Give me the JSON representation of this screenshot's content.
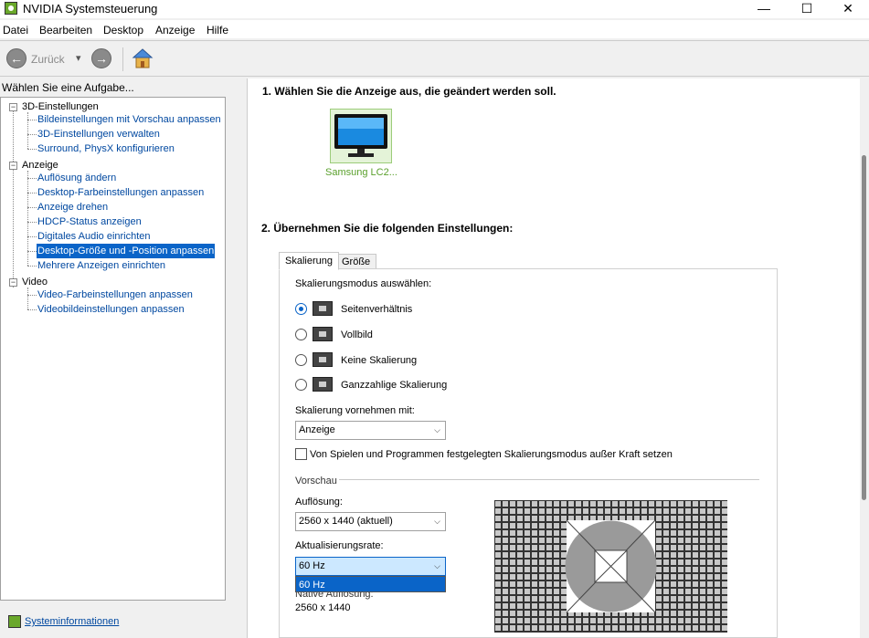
{
  "window": {
    "title": "NVIDIA Systemsteuerung",
    "controls": {
      "minimize": "—",
      "maximize": "☐",
      "close": "✕"
    }
  },
  "menu": [
    "Datei",
    "Bearbeiten",
    "Desktop",
    "Anzeige",
    "Hilfe"
  ],
  "toolbar": {
    "back_label": "Zurück",
    "back_arrow": "←",
    "forward_arrow": "→",
    "dropdown_caret": "▾"
  },
  "sidebar": {
    "task_label": "Wählen Sie eine Aufgabe...",
    "categories": [
      {
        "label": "3D-Einstellungen",
        "toggle": "−",
        "items": [
          {
            "label": "Bildeinstellungen mit Vorschau anpassen"
          },
          {
            "label": "3D-Einstellungen verwalten"
          },
          {
            "label": "Surround, PhysX konfigurieren"
          }
        ]
      },
      {
        "label": "Anzeige",
        "toggle": "−",
        "items": [
          {
            "label": "Auflösung ändern"
          },
          {
            "label": "Desktop-Farbeinstellungen anpassen"
          },
          {
            "label": "Anzeige drehen"
          },
          {
            "label": "HDCP-Status anzeigen"
          },
          {
            "label": "Digitales Audio einrichten"
          },
          {
            "label": "Desktop-Größe und -Position anpassen",
            "selected": true
          },
          {
            "label": "Mehrere Anzeigen einrichten"
          }
        ]
      },
      {
        "label": "Video",
        "toggle": "−",
        "items": [
          {
            "label": "Video-Farbeinstellungen anpassen"
          },
          {
            "label": "Videobildeinstellungen anpassen"
          }
        ]
      }
    ],
    "system_info": "Systeminformationen"
  },
  "main": {
    "step1_heading": "1. Wählen Sie die Anzeige aus, die geändert werden soll.",
    "display_name": "Samsung LC2...",
    "step2_heading": "2. Übernehmen Sie die folgenden Einstellungen:",
    "tabs": [
      {
        "label": "Skalierung",
        "active": true
      },
      {
        "label": "Größe",
        "active": false
      }
    ],
    "scaling": {
      "mode_label": "Skalierungsmodus auswählen:",
      "modes": [
        {
          "label": "Seitenverhältnis",
          "selected": true
        },
        {
          "label": "Vollbild",
          "selected": false
        },
        {
          "label": "Keine Skalierung",
          "selected": false
        },
        {
          "label": "Ganzzahlige Skalierung",
          "selected": false
        }
      ],
      "perform_label": "Skalierung vornehmen mit:",
      "perform_value": "Anzeige",
      "override_label": "Von Spielen und Programmen festgelegten Skalierungsmodus außer Kraft setzen",
      "override_checked": false
    },
    "preview": {
      "section_label": "Vorschau",
      "resolution_label": "Auflösung:",
      "resolution_value": "2560 x 1440 (aktuell)",
      "refresh_label": "Aktualisierungsrate:",
      "refresh_value": "60 Hz",
      "refresh_options": [
        "60 Hz"
      ],
      "native_label": "Native Auflösung:",
      "native_value": "2560 x 1440"
    }
  },
  "colors": {
    "selection": "#0a64c8",
    "link": "#0048a0",
    "nvidia_green": "#76b900",
    "display_label": "#5aa02c"
  }
}
